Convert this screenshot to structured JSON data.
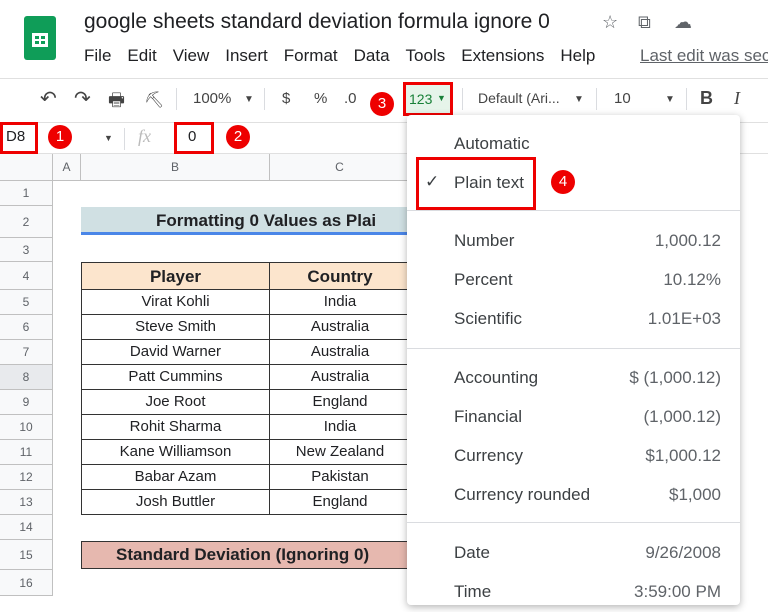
{
  "app": {
    "title": "google sheets standard deviation formula ignore 0",
    "last_edit": "Last edit was sec"
  },
  "menu": [
    "File",
    "Edit",
    "View",
    "Insert",
    "Format",
    "Data",
    "Tools",
    "Extensions",
    "Help"
  ],
  "toolbar": {
    "zoom": "100%",
    "currency": "$",
    "percent": "%",
    "decimal": ".0",
    "format": "123",
    "font": "Default (Ari...",
    "size": "10",
    "bold": "B",
    "italic": "I"
  },
  "formula": {
    "cell_ref": "D8",
    "fx": "fx",
    "value": "0"
  },
  "badges": [
    "1",
    "2",
    "3",
    "4"
  ],
  "columns": [
    "A",
    "B",
    "C"
  ],
  "rows": [
    "1",
    "2",
    "3",
    "4",
    "5",
    "6",
    "7",
    "8",
    "9",
    "10",
    "11",
    "12",
    "13",
    "14",
    "15",
    "16"
  ],
  "sheet": {
    "title": "Formatting 0 Values as Plai",
    "headers": [
      "Player",
      "Country"
    ],
    "data": [
      [
        "Virat Kohli",
        "India"
      ],
      [
        "Steve Smith",
        "Australia"
      ],
      [
        "David Warner",
        "Australia"
      ],
      [
        "Patt Cummins",
        "Australia"
      ],
      [
        "Joe Root",
        "England"
      ],
      [
        "Rohit Sharma",
        "India"
      ],
      [
        "Kane Williamson",
        "New Zealand"
      ],
      [
        "Babar Azam",
        "Pakistan"
      ],
      [
        "Josh Buttler",
        "England"
      ]
    ],
    "sd_label": "Standard Deviation (Ignoring 0)"
  },
  "dropdown": {
    "items": [
      {
        "label": "Automatic",
        "example": ""
      },
      {
        "label": "Plain text",
        "example": "",
        "checked": true
      },
      {
        "label": "Number",
        "example": "1,000.12"
      },
      {
        "label": "Percent",
        "example": "10.12%"
      },
      {
        "label": "Scientific",
        "example": "1.01E+03"
      },
      {
        "label": "Accounting",
        "example": "$ (1,000.12)"
      },
      {
        "label": "Financial",
        "example": "(1,000.12)"
      },
      {
        "label": "Currency",
        "example": "$1,000.12"
      },
      {
        "label": "Currency rounded",
        "example": "$1,000"
      },
      {
        "label": "Date",
        "example": "9/26/2008"
      },
      {
        "label": "Time",
        "example": "3:59:00 PM"
      }
    ]
  },
  "colors": {
    "accent": "#e00000",
    "title_fill": "#d0e0e3",
    "header_fill": "#fce5cd",
    "sd_fill": "#e6b8af",
    "green": "#0f9d58"
  }
}
